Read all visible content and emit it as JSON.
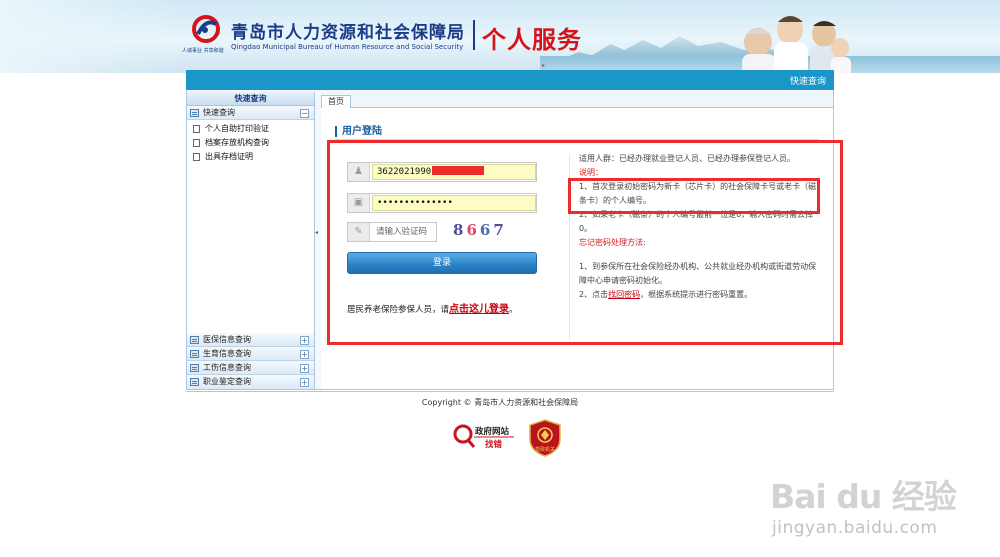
{
  "header": {
    "title_cn": "青岛市人力资源和社会保障局",
    "title_en": "Qingdao Municipal Bureau of Human Resource and Social Security",
    "service": "个人服务",
    "logo_sub": "人城事业  共享和谐"
  },
  "topbar": {
    "quick_link": "快速查询"
  },
  "sidebar": {
    "header": "快速查询",
    "open_group": "快速查询",
    "items": [
      "个人自助打印验证",
      "档案存放机构查询",
      "出具存档证明"
    ],
    "collapsed_groups": [
      "医保信息查询",
      "生育信息查询",
      "工伤信息查询",
      "职业鉴定查询"
    ],
    "toggle_open": "−",
    "toggle_closed": "+"
  },
  "tabs": [
    "首页"
  ],
  "login": {
    "section_title": "用户登陆",
    "username_value": "3622021990",
    "password_value": "••••••••••••••",
    "captcha_placeholder": "请输入验证码",
    "captcha_code": [
      "8",
      "6",
      "6",
      "7"
    ],
    "login_button": "登录",
    "resident_prefix": "居民养老保险参保人员，请",
    "resident_link": "点击这儿登录",
    "resident_suffix": "。"
  },
  "info": {
    "applicable": "适用人群：已经办理就业登记人员、已经办理参保登记人员。",
    "note_label": "说明：",
    "note1": "1、首次登录初始密码为新卡（芯片卡）的社会保障卡号或老卡（磁条卡）的个人编号。",
    "note2": "2、如果老卡（磁条）的个人编号最前一位是0，输入密码时需去掉0。",
    "forgot_label": "忘记密码处理方法:",
    "forgot1": "1、到参保所在社会保险经办机构、公共就业经办机构或街道劳动保障中心申请密码初始化。",
    "forgot2_prefix": "2、点击",
    "forgot2_link": "找回密码",
    "forgot2_suffix": "，根据系统提示进行密码重置。"
  },
  "footer": {
    "copyright": "Copyright © 青岛市人力资源和社会保障局",
    "gov_site": "政府网站",
    "gov_error": "找错",
    "shield_text": "党政机关"
  },
  "watermark": {
    "brand": "Bai du 经验",
    "url": "jingyan.baidu.com"
  },
  "colors": {
    "primary_blue": "#1a96c9",
    "title_blue": "#1b3d88",
    "accent_red": "#d6121b",
    "annotation_red": "#ee2c2c"
  }
}
